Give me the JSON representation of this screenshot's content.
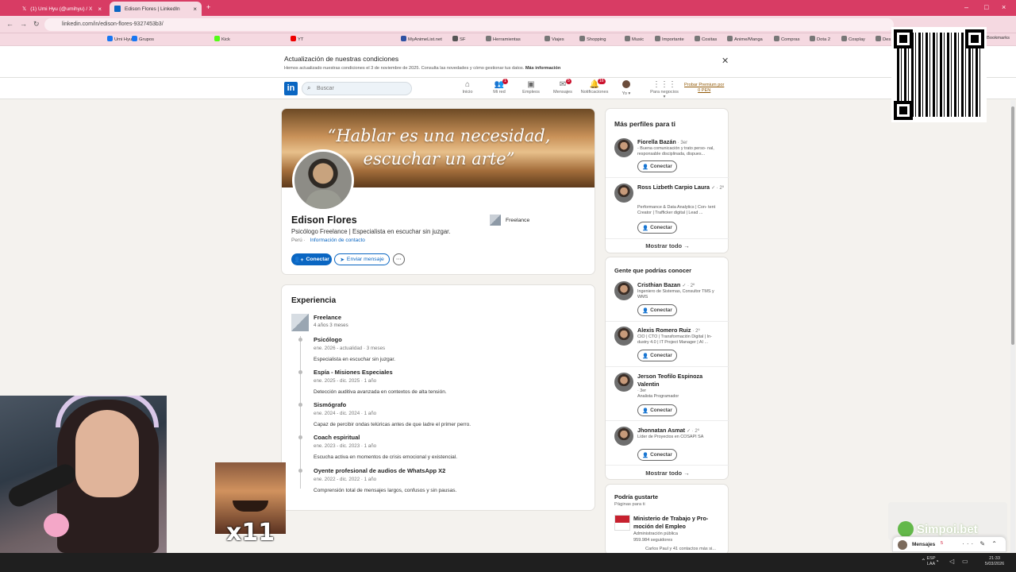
{
  "browser": {
    "tabs": [
      {
        "title": "(1) Umi Hyu (@umihyu) / X",
        "active": false
      },
      {
        "title": "Edison Flores | LinkedIn",
        "active": true
      }
    ],
    "url": "linkedin.com/in/edison-flores-9327453b3/",
    "bookmarks": [
      "Umi Hyu",
      "Grupos",
      "Kick",
      "YT",
      "MyAnimeList.net",
      "SF",
      "Herramientas",
      "Viajes",
      "Shopping",
      "Music",
      "Importante",
      "Cositas",
      "Anime/Manga",
      "Compras",
      "Dota 2",
      "Cosplay",
      "Des",
      "Bookmarks"
    ]
  },
  "banner": {
    "title": "Actualización de nuestras condiciones",
    "desc": "Hemos actualizado nuestras condiciones el 3 de noviembre de 2025. Consulta las novedades y cómo gestionar tus datos.",
    "link": "Más información"
  },
  "nav": {
    "search_placeholder": "Buscar",
    "items": [
      {
        "label": "Inicio",
        "badge": ""
      },
      {
        "label": "Mi red",
        "badge": "1"
      },
      {
        "label": "Empleos",
        "badge": ""
      },
      {
        "label": "Mensajes",
        "badge": "5"
      },
      {
        "label": "Notificaciones",
        "badge": "16"
      },
      {
        "label": "Yo",
        "badge": ""
      },
      {
        "label": "Para negocios",
        "badge": ""
      }
    ],
    "premium_line1": "Probar Premium por",
    "premium_line2": "0 PEN"
  },
  "profile": {
    "cover_quote_1": "“Hablar es una necesidad,",
    "cover_quote_2": "escuchar un arte”",
    "name": "Edison Flores",
    "headline": "Psicólogo Freelance | Especialista en escuchar sin juzgar.",
    "location": "Perú",
    "contact_link": "Información de contacto",
    "company": "Freelance",
    "connect": "Conectar",
    "message": "Enviar mensaje",
    "more": "···"
  },
  "experience": {
    "title": "Experiencia",
    "company": "Freelance",
    "duration": "4 años 3 meses",
    "roles": [
      {
        "title": "Psicólogo",
        "dates": "ene. 2026 - actualidad · 3 meses",
        "desc": "Especialista en escuchar sin juzgar."
      },
      {
        "title": "Espía - Misiones Especiales",
        "dates": "ene. 2025 - dic. 2025 · 1 año",
        "desc": "Detección auditiva avanzada en contextos de alta tensión."
      },
      {
        "title": "Sismógrafo",
        "dates": "ene. 2024 - dic. 2024 · 1 año",
        "desc": "Capaz de percibir ondas telúricas antes de que ladre el primer perro."
      },
      {
        "title": "Coach espiritual",
        "dates": "ene. 2023 - dic. 2023 · 1 año",
        "desc": "Escucha activa en momentos de crisis emocional y existencial."
      },
      {
        "title": "Oyente profesional de audios de WhatsApp X2",
        "dates": "ene. 2022 - dic. 2022 · 1 año",
        "desc": "Comprensión total de mensajes largos, confusos y sin pausas."
      }
    ]
  },
  "sidebar": {
    "more_profiles": {
      "title": "Más perfiles para ti",
      "people": [
        {
          "name": "Fiorella Bazán",
          "degree": "· 3er",
          "desc": "- Buena comunicación y trato perso- nal, responsable disciplinada, dispues..."
        },
        {
          "name": "Ross Lizbeth Carpio Laura",
          "degree": "✓ · 2º",
          "desc": "Performance & Data Analytics | Con- tent Creator | Trafficker digital | Lead ..."
        }
      ],
      "show_all": "Mostrar todo →"
    },
    "people_you_may_know": {
      "title": "Gente que podrías conocer",
      "people": [
        {
          "name": "Cristhian Bazan",
          "degree": "✓ · 2º",
          "desc": "Ingeniero de Sistemas, Consultor TMS y WMS"
        },
        {
          "name": "Alexis Romero Ruiz",
          "degree": "· 2º",
          "desc": "CIO | CTO | Transformación Digital | In- dustry 4.0 | IT Project Manager | AI ..."
        },
        {
          "name": "Jerson Teofilo Espinoza Valentin",
          "degree": "· 3er",
          "desc": "Analista Programador"
        },
        {
          "name": "Jhonnatan Asmat",
          "degree": "✓ · 2º",
          "desc": "Líder de Proyectos en COSAPI SA"
        }
      ],
      "show_all": "Mostrar todo →",
      "connect": "Conectar"
    },
    "might_like": {
      "title": "Podría gustarte",
      "subtitle": "Páginas para ti",
      "page_name": "Ministerio de Trabajo y Pro- moción del Empleo",
      "page_type": "Administración pública",
      "followers": "959.984 seguidores",
      "mutual": "Carlos Paul y 41 contactos más si..."
    }
  },
  "overlays": {
    "multiplier": "x11",
    "sponsor": "Simpoi.bet",
    "messages_label": "Mensajes",
    "messages_count": "5"
  },
  "taskbar": {
    "lang": "ESP",
    "lang2": "LAA",
    "time": "21:33",
    "date": "5/03/2026"
  }
}
